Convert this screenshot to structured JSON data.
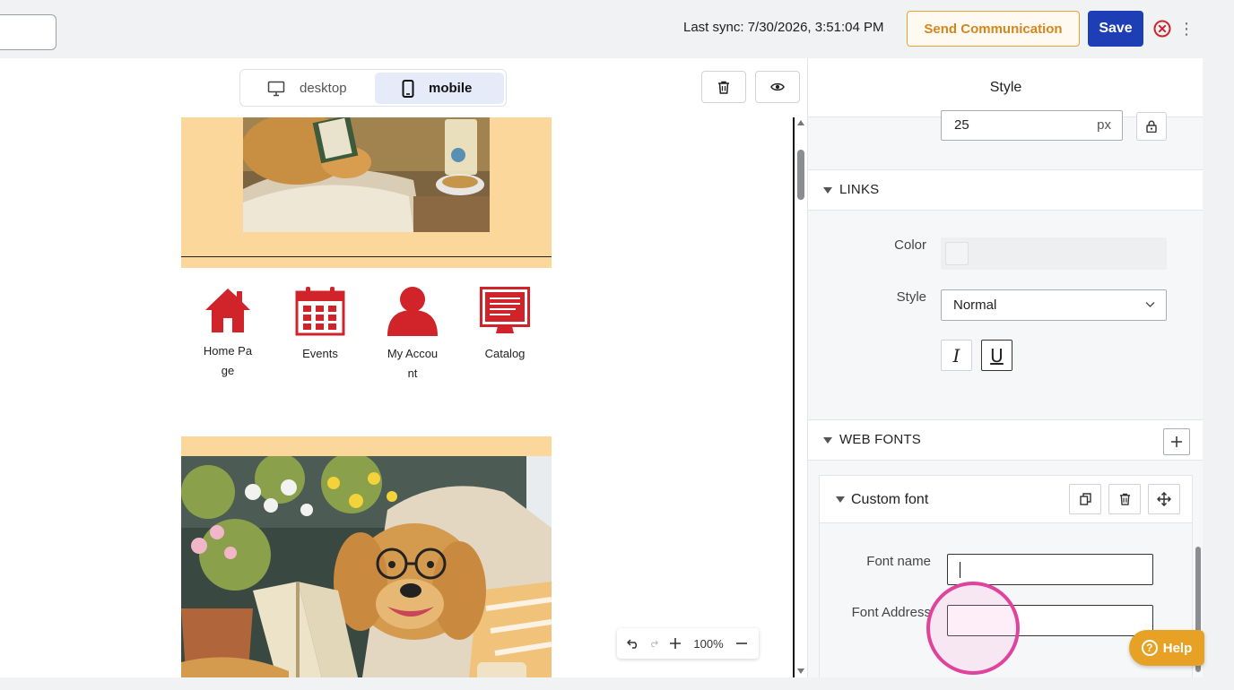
{
  "header": {
    "last_sync": "Last sync: 7/30/2026, 3:51:04 PM",
    "send_label": "Send Communication",
    "save_label": "Save",
    "close_icon": "close-circle-icon",
    "more_icon": "kebab-icon"
  },
  "view_toggle": {
    "desktop_label": "desktop",
    "mobile_label": "mobile",
    "selected": "mobile"
  },
  "canvas": {
    "nav_items": [
      {
        "label": "Home Page",
        "icon": "home-icon"
      },
      {
        "label": "Events",
        "icon": "calendar-icon"
      },
      {
        "label": "My Account",
        "icon": "user-icon"
      },
      {
        "label": "Catalog",
        "icon": "monitor-icon"
      }
    ],
    "zoom": "100%",
    "accent_color": "#d0232a",
    "peach_color": "#fbd79b"
  },
  "panel": {
    "title": "Style",
    "size_value": "25",
    "size_unit": "px",
    "links": {
      "heading": "LINKS",
      "color_label": "Color",
      "style_label": "Style",
      "style_value": "Normal",
      "italic_label": "I",
      "underline_label": "U"
    },
    "web_fonts": {
      "heading": "WEB FONTS",
      "card_title": "Custom font",
      "font_name_label": "Font name",
      "font_name_value": "",
      "font_address_label": "Font Address",
      "font_address_value": ""
    }
  },
  "help": {
    "label": "Help"
  }
}
